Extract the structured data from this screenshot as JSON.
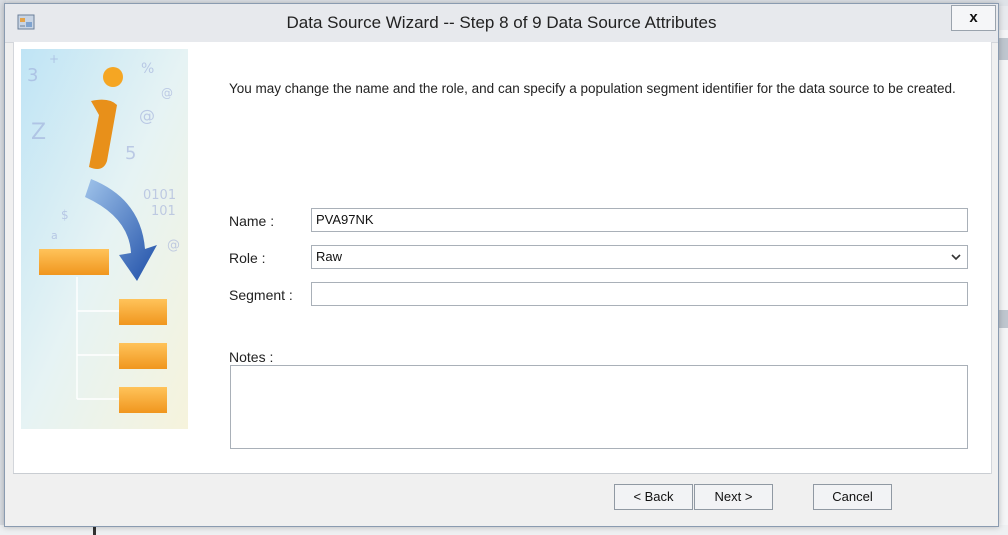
{
  "dialog": {
    "title": "Data Source Wizard  -- Step 8 of 9  Data Source Attributes",
    "close_label": "x"
  },
  "intro_text": "You may change the name and the role, and can specify a population segment identifier for the data source to be created.",
  "form": {
    "name_label": "Name :",
    "name_value": "PVA97NK",
    "role_label": "Role :",
    "role_value": "Raw",
    "segment_label": "Segment :",
    "segment_value": "",
    "notes_label": "Notes :",
    "notes_value": ""
  },
  "buttons": {
    "back": "< Back",
    "next": "Next >",
    "cancel": "Cancel"
  },
  "colors": {
    "accent_orange": "#f5a623",
    "arrow_blue": "#1f5fb8"
  }
}
